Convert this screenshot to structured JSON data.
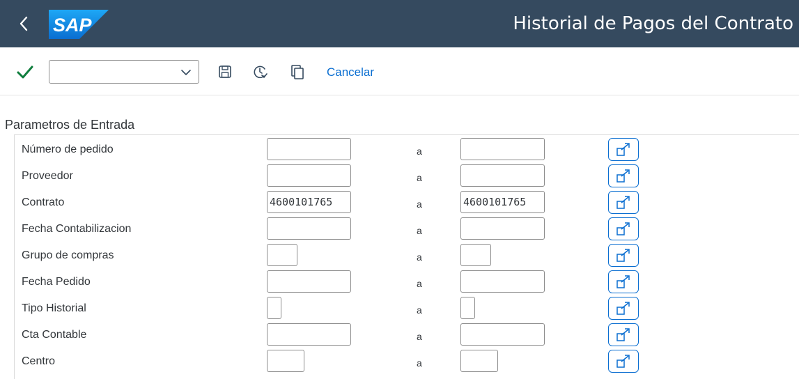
{
  "shell": {
    "logo_text": "SAP",
    "title": "Historial de Pagos del Contrato"
  },
  "toolbar": {
    "command_field_value": "",
    "cancel_label": "Cancelar"
  },
  "form": {
    "section_title": "Parametros de Entrada",
    "range_separator": "a",
    "rows": [
      {
        "label": "Número de pedido",
        "from": "",
        "to": ""
      },
      {
        "label": "Proveedor",
        "from": "",
        "to": ""
      },
      {
        "label": "Contrato",
        "from": "4600101765",
        "to": "4600101765"
      },
      {
        "label": "Fecha Contabilizacion",
        "from": "",
        "to": ""
      },
      {
        "label": "Grupo de compras",
        "from": "",
        "to": ""
      },
      {
        "label": "Fecha Pedido",
        "from": "",
        "to": ""
      },
      {
        "label": "Tipo Historial",
        "from": "",
        "to": ""
      },
      {
        "label": "Cta Contable",
        "from": "",
        "to": ""
      },
      {
        "label": "Centro",
        "from": "",
        "to": ""
      }
    ]
  },
  "colors": {
    "shell_bg": "#354a5f",
    "accent": "#0a6ed1",
    "check": "#107e3e"
  },
  "icons": {
    "back": "back-chevron-icon",
    "confirm": "checkmark-icon",
    "save": "save-icon",
    "variant": "get-variant-icon",
    "copy": "copy-icon",
    "multiple_selection": "multiple-selection-icon"
  }
}
